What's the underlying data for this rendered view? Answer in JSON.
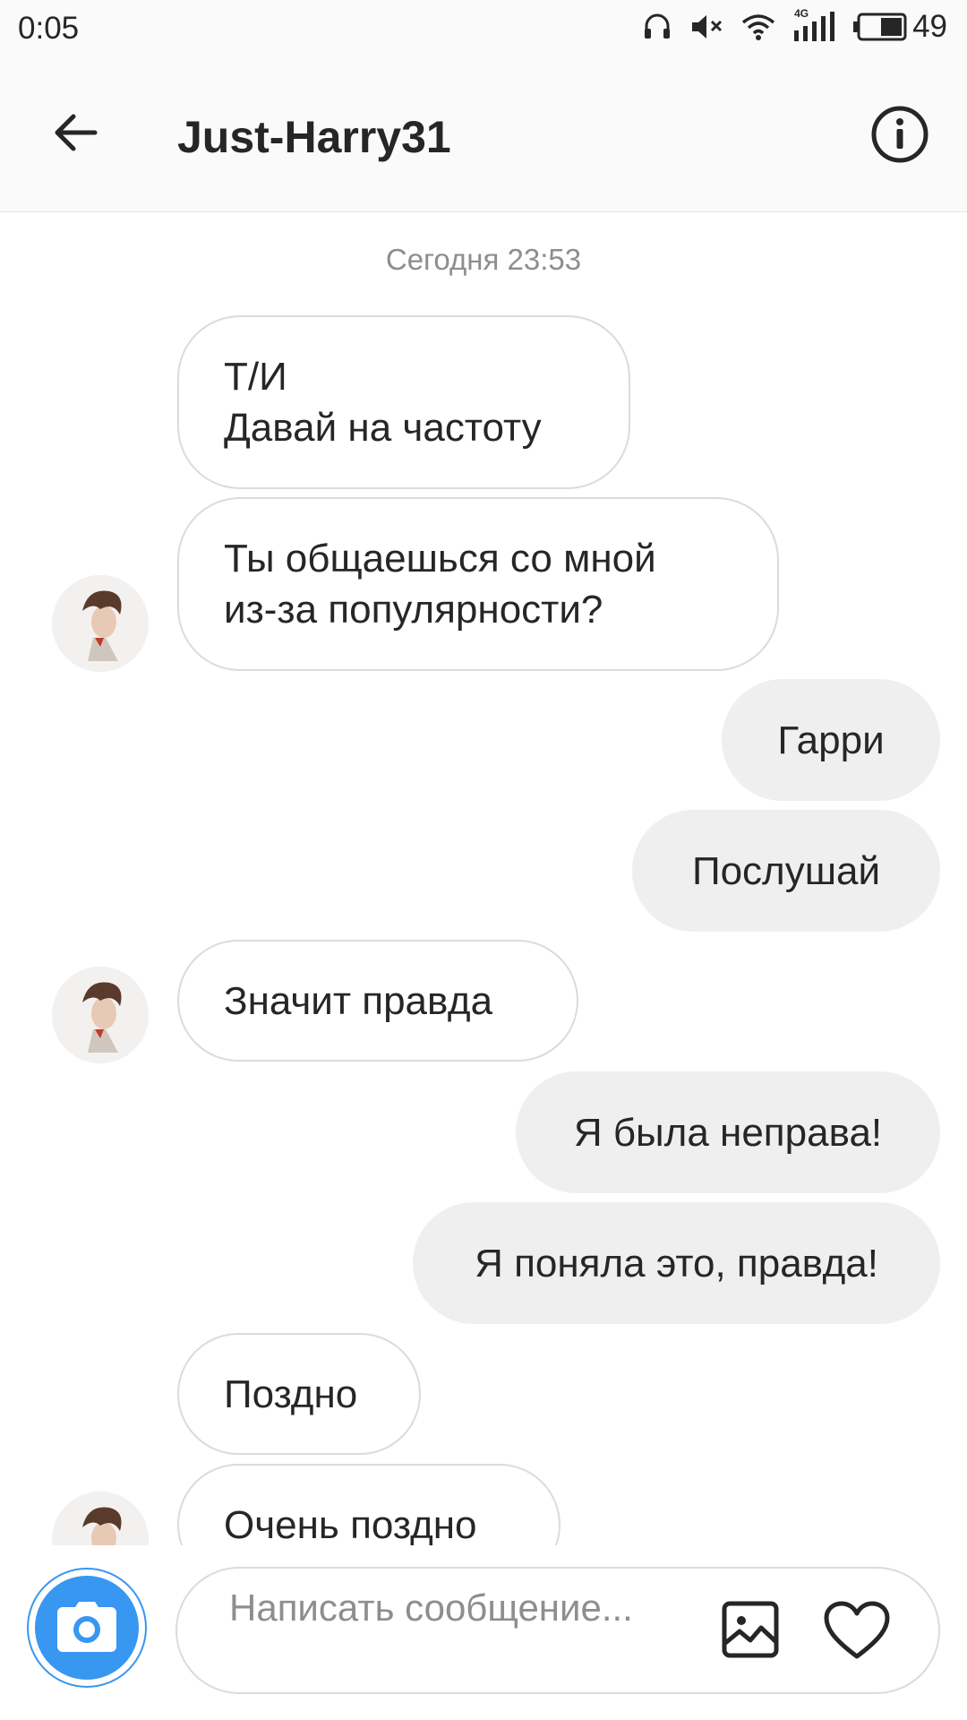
{
  "status_bar": {
    "time": "0:05",
    "network_label": "4G",
    "battery": "49"
  },
  "header": {
    "title": "Just-Harry31",
    "back_icon": "arrow-left-icon",
    "info_icon": "info-icon"
  },
  "chat": {
    "timestamp": "Сегодня 23:53",
    "messages": [
      {
        "direction": "in",
        "text": "Т/И\nДавай на частоту"
      },
      {
        "direction": "in",
        "text": "Ты общаешься со мной\nиз-за популярности?"
      },
      {
        "direction": "out",
        "text": "Гарри"
      },
      {
        "direction": "out",
        "text": "Послушай"
      },
      {
        "direction": "in",
        "text": "Значит правда"
      },
      {
        "direction": "out",
        "text": "Я была неправа!"
      },
      {
        "direction": "out",
        "text": "Я поняла это, правда!"
      },
      {
        "direction": "in",
        "text": "Поздно"
      },
      {
        "direction": "in",
        "text": "Очень поздно"
      }
    ]
  },
  "composer": {
    "placeholder": "Написать сообщение...",
    "camera_icon": "camera-icon",
    "gallery_icon": "image-icon",
    "heart_icon": "heart-icon",
    "accent": "#3897f0"
  }
}
